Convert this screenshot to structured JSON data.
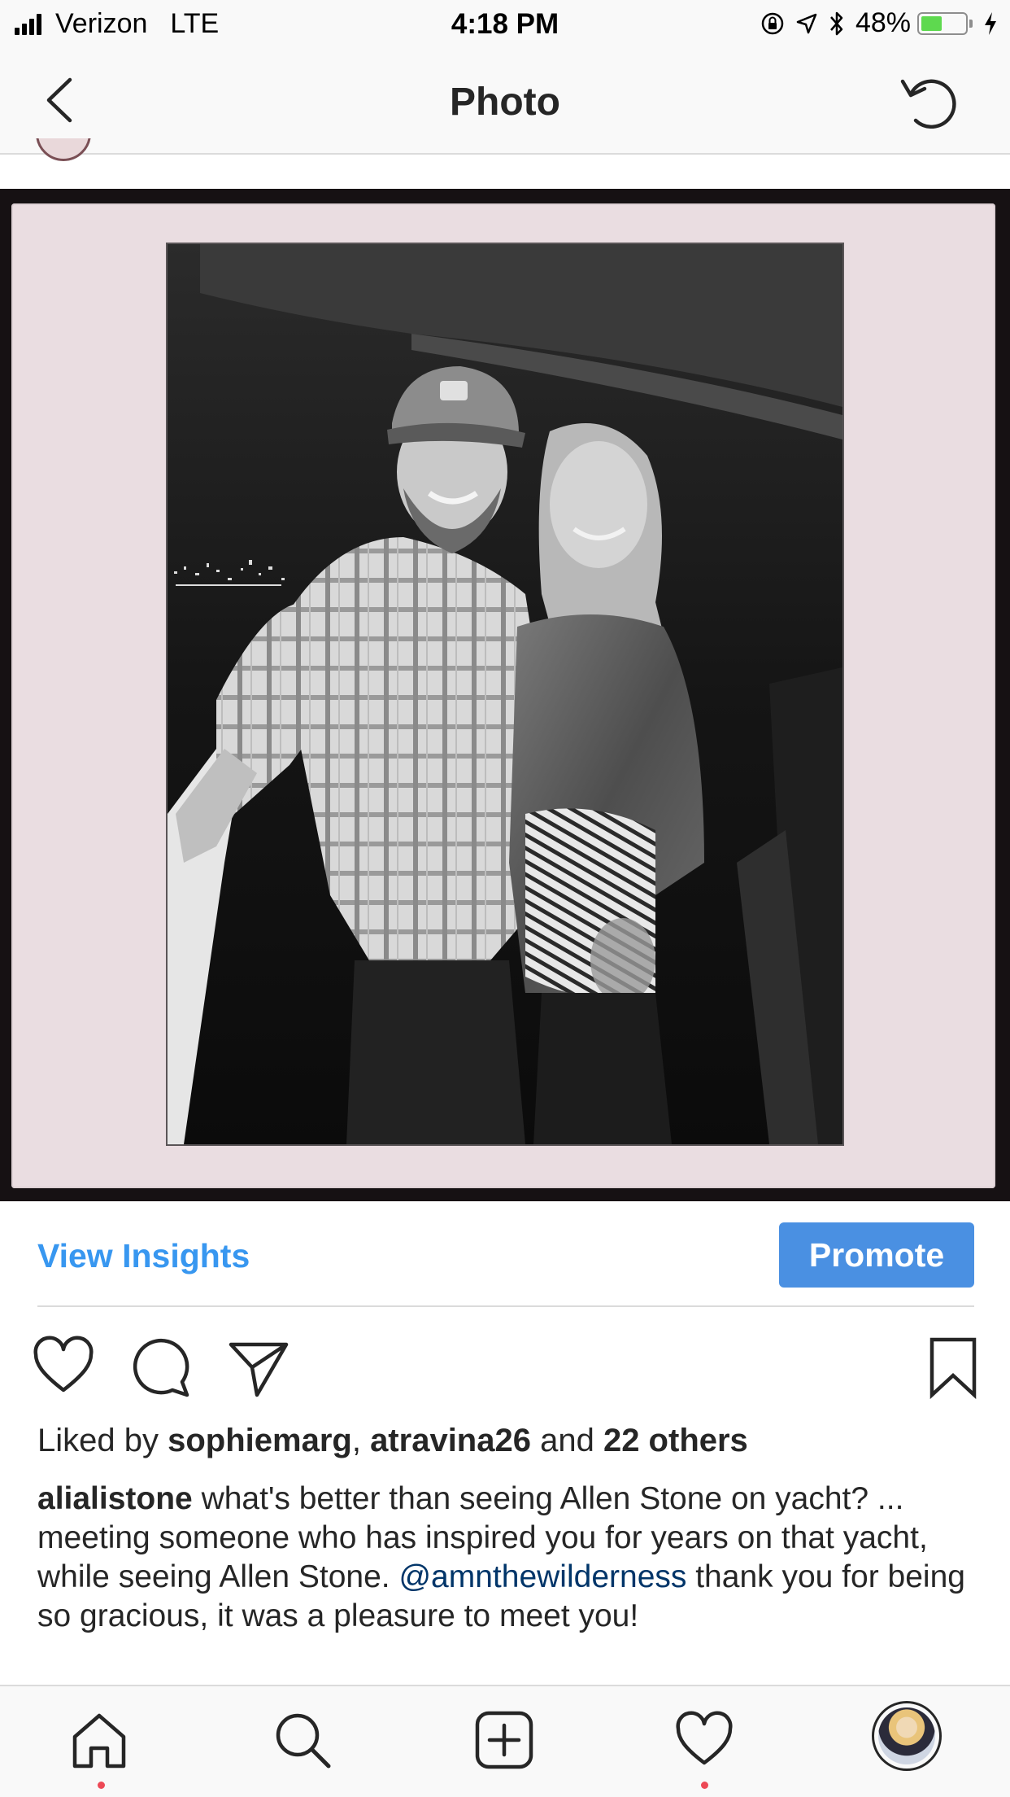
{
  "status_bar": {
    "carrier": "Verizon",
    "network": "LTE",
    "time": "4:18 PM",
    "battery_percent": "48%",
    "battery_level": 0.48,
    "icons": [
      "signal-icon",
      "orientation-lock-icon",
      "location-arrow-icon",
      "bluetooth-icon",
      "battery-icon",
      "charging-icon"
    ]
  },
  "nav": {
    "title": "Photo",
    "back_icon": "chevron-left-icon",
    "refresh_icon": "refresh-icon"
  },
  "post": {
    "image_icon": "photo",
    "insights_label": "View Insights",
    "promote_label": "Promote",
    "likes": {
      "prefix": "Liked by ",
      "user1": "sophiemarg",
      "separator": ", ",
      "user2": "atravina26",
      "and": " and ",
      "others": "22 others"
    },
    "caption": {
      "username": "alialistone",
      "text1": " what's better than seeing Allen Stone on yacht? ... meeting someone who has inspired you for years on that yacht, while seeing Allen Stone. ",
      "mention": "@amnthewilderness",
      "text2": " thank you for being so gracious, it was a pleasure to meet you!"
    },
    "actions": [
      "heart-icon",
      "comment-icon",
      "share-icon",
      "bookmark-icon"
    ]
  },
  "tab_bar": {
    "tabs": [
      "home-icon",
      "search-icon",
      "add-icon",
      "activity-heart-icon",
      "profile-avatar"
    ]
  },
  "colors": {
    "link_blue": "#3897f0",
    "promote_blue": "#4a90e2",
    "mention_blue": "#003569",
    "notification_red": "#ed4956",
    "battery_green": "#5ed94f"
  }
}
